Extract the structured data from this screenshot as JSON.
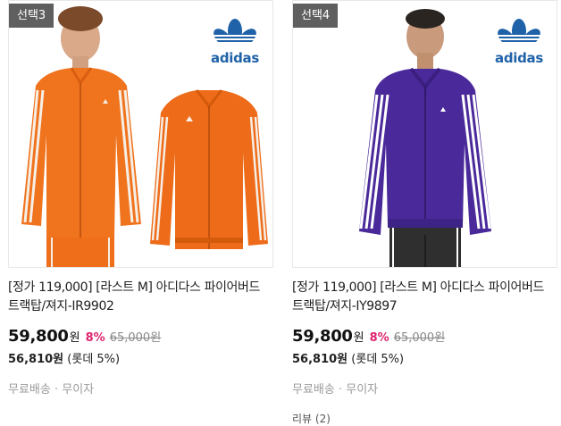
{
  "products": [
    {
      "badge": "선택3",
      "brand": "adidas",
      "title": "[정가 119,000] [라스트 M] 아디다스 파이어버드 트랙탑/져지-IR9902",
      "price": "59,800",
      "price_unit": "원",
      "discount": "8%",
      "original_price": "65,000원",
      "card_price": "56,810원",
      "card_note": "(롯데 5%)",
      "shipping": "무료배송 · 무이자",
      "colors": {
        "jacket": "#f0731e",
        "stripe": "#f6efe6"
      }
    },
    {
      "badge": "선택4",
      "brand": "adidas",
      "title": "[정가 119,000] [라스트 M] 아디다스 파이어버드 트랙탑/져지-IY9897",
      "price": "59,800",
      "price_unit": "원",
      "discount": "8%",
      "original_price": "65,000원",
      "card_price": "56,810원",
      "card_note": "(롯데 5%)",
      "shipping": "무료배송 · 무이자",
      "review": "리뷰 (2)",
      "colors": {
        "jacket": "#4a2a9a",
        "stripe": "#ffffff"
      }
    }
  ]
}
